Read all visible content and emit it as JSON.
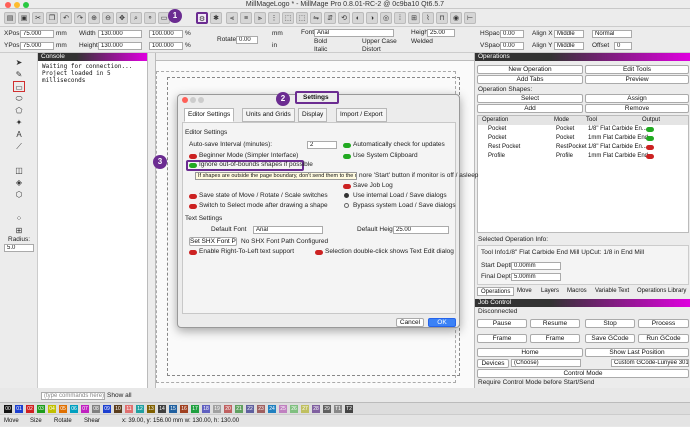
{
  "window": {
    "title": "MillMageLogo * - MillMage Pro 0.8.01-RC-2 @ 0c9ba10 Qt6.5.7"
  },
  "props": {
    "xpos_label": "XPos",
    "xpos": "75.000",
    "ypos_label": "YPos",
    "ypos": "75.000",
    "unit": "mm",
    "width_label": "Width",
    "width": "130.000",
    "height_label": "Height",
    "height": "130.000",
    "w_pct": "100.000",
    "h_pct": "100.000",
    "pct": "%",
    "rotate_label": "Rotate",
    "rotate": "0.00",
    "mm": "mm",
    "in": "in",
    "font_label": "Font",
    "font": "Arial",
    "height2_label": "Height",
    "height2": "25.00",
    "bold": "Bold",
    "upper": "Upper Case",
    "welded": "Welded",
    "italic": "Italic",
    "distort": "Distort",
    "hspace_label": "HSpace",
    "hspace": "0.00",
    "vspace_label": "VSpace",
    "vspace": "0.00",
    "alignx_label": "Align X",
    "alignx": "Middle",
    "aligny_label": "Align Y",
    "aligny": "Middle",
    "normal": "Normal",
    "offset_label": "Offset",
    "offset": "0"
  },
  "console": {
    "title": "Console",
    "lines": [
      "Waiting for connection...",
      "Project loaded in 5",
      "milliseconds"
    ],
    "cmd_placeholder": "(type commands here)",
    "show_all": "Show all"
  },
  "left": {
    "radius_label": "Radius:",
    "radius": "5.0"
  },
  "dialog": {
    "tabs": [
      "Editor Settings",
      "Units and Grids",
      "Display",
      "Import / Export"
    ],
    "section1": "Editor Settings",
    "autosave_label": "Auto-save Interval (minutes):",
    "autosave": "2",
    "auto_check": "Automatically check for updates",
    "beginner": "Beginner Mode (Simpler Interface)",
    "sys_clip": "Use System Clipboard",
    "ignore_oob": "Ignore out-of-bounds shapes if possible",
    "tooltip": "If shapes are outside the page boundary, don't send them to the machine.",
    "ignore_start": "nore 'Start' button if monitor is off / asleep",
    "save_log": "Save Job Log",
    "save_state": "Save state of Move / Rotate / Scale switches",
    "use_internal": "Use internal Load / Save dialogs",
    "switch_select": "Switch to Select mode after drawing a shape",
    "bypass": "Bypass system Load / Save dialogs",
    "section2": "Text Settings",
    "def_font_label": "Default Font",
    "def_font": "Arial",
    "def_height_label": "Default Height",
    "def_height": "25.00",
    "set_shx": "Set SHX Font Path",
    "no_shx": "No SHX Font Path Configured",
    "rtl": "Enable Right-To-Left text support",
    "dblclick": "Selection double-click shows Text Edit dialog",
    "cancel": "Cancel",
    "ok": "OK"
  },
  "callouts": [
    "1",
    "2",
    "3"
  ],
  "callout2_label": "Settings",
  "operations": {
    "title": "Operations",
    "new_op": "New Operation",
    "edit_tools": "Edit Tools",
    "add_tabs": "Add Tabs",
    "preview": "Preview",
    "shapes_label": "Operation Shapes:",
    "select": "Select",
    "assign": "Assign",
    "add": "Add",
    "remove": "Remove",
    "headers": [
      "Operation",
      "Mode",
      "Tool",
      "Output"
    ],
    "rows": [
      {
        "op": "Pocket",
        "mode": "Pocket",
        "tool": "1/8\" Flat Carbide En..."
      },
      {
        "op": "Pocket",
        "mode": "Pocket",
        "tool": "1mm Flat Carbide End..."
      },
      {
        "op": "Rest Pocket",
        "mode": "RestPocket",
        "tool": "1/8\" Flat Carbide En..."
      },
      {
        "op": "Profile",
        "mode": "Profile",
        "tool": "1mm Flat Carbide End..."
      }
    ],
    "sel_info": "Selected Operation Info:",
    "tool_info_label": "Tool Info:",
    "tool_info": "1/8\" Flat Carbide End Mill UpCut: 1/8 in End Mill",
    "start_depth_label": "Start Depth:",
    "start_depth": "0.00mm",
    "final_depth_label": "Final Depth:",
    "final_depth": "5.00mm",
    "bottom_tabs": [
      "Operations",
      "Move",
      "Layers",
      "Macros",
      "Variable Text",
      "Operations Library"
    ]
  },
  "job": {
    "title": "Job Control",
    "status": "Disconnected",
    "pause": "Pause",
    "resume": "Resume",
    "stop": "Stop",
    "process": "Process",
    "frame1": "Frame",
    "frame2": "Frame",
    "save_gcode": "Save GCode",
    "run_gcode": "Run GCode",
    "home": "Home",
    "show_last": "Show Last Position",
    "devices": "Devices",
    "choose": "(Choose)",
    "custom": "Custom GCode-Lunyee 3018",
    "control_mode": "Control Mode",
    "require": "Require Control Mode before Start/Send"
  },
  "palette": [
    "00",
    "01",
    "02",
    "03",
    "04",
    "05",
    "06",
    "07",
    "08",
    "09",
    "10",
    "11",
    "12",
    "13",
    "14",
    "15",
    "16",
    "17",
    "18",
    "19",
    "20",
    "21",
    "22",
    "23",
    "24",
    "25",
    "26",
    "27",
    "28",
    "29",
    "T1",
    "T2"
  ],
  "palette_colors": [
    "#111",
    "#1c3fd0",
    "#d02020",
    "#1c9c1c",
    "#c0c000",
    "#e07000",
    "#00a0c0",
    "#c020c0",
    "#808080",
    "#1c3fd0",
    "#5a3c1c",
    "#e07070",
    "#20a0a0",
    "#806000",
    "#404040",
    "#2060a0",
    "#a04020",
    "#20a040",
    "#6060c0",
    "#a0a0a0",
    "#c06060",
    "#60a060",
    "#6060a0",
    "#a06060",
    "#2080c0",
    "#c080c0",
    "#80c080",
    "#c0c060",
    "#8060a0",
    "#606060",
    "#888",
    "#444"
  ],
  "status": {
    "move": "Move",
    "size": "Size",
    "rotate": "Rotate",
    "shear": "Shear",
    "coords": "x: 39.00, y: 156.00 mm   w: 130.00,  h: 130.00"
  }
}
